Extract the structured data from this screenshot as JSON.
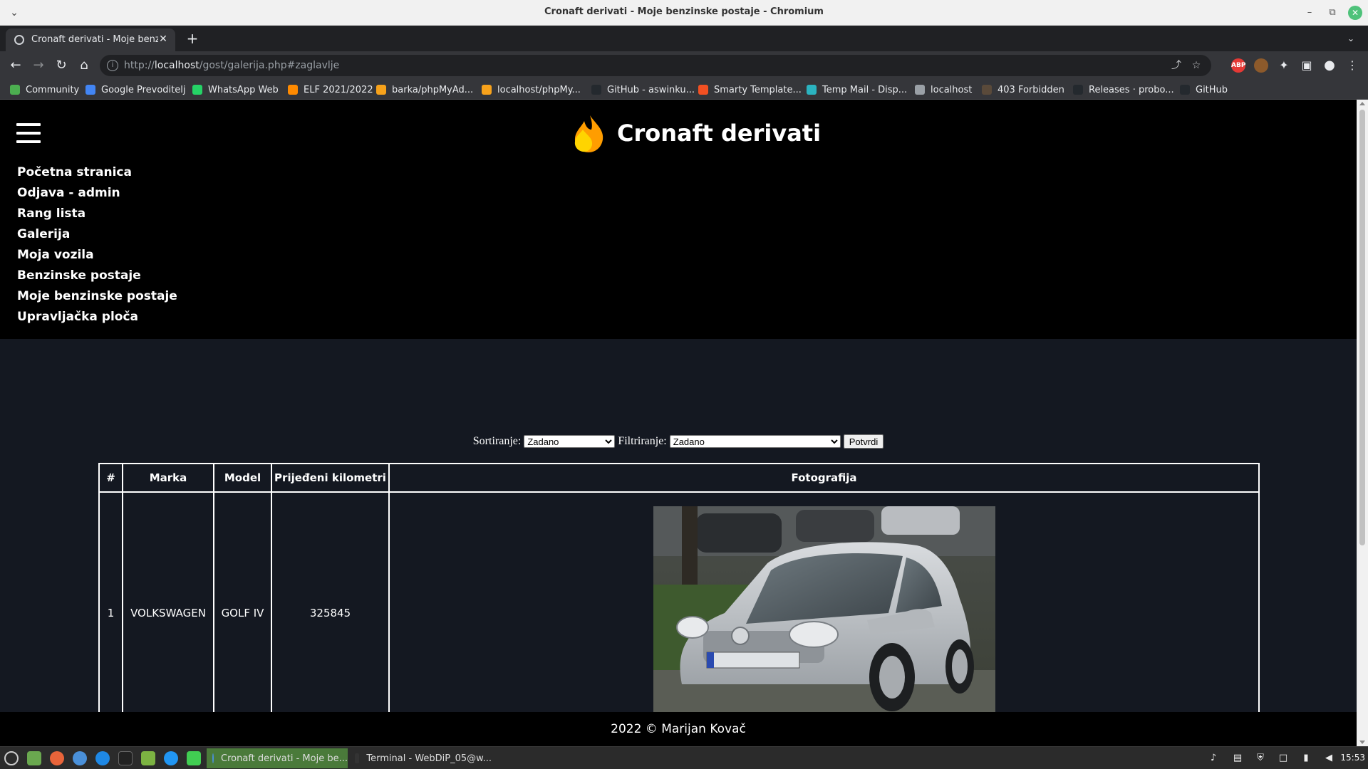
{
  "window": {
    "title": "Cronaft derivati - Moje benzinske postaje - Chromium"
  },
  "tab": {
    "title": "Cronaft derivati - Moje benzinske postaje"
  },
  "omnibox": {
    "url_prefix": "http://",
    "url_host": "localhost",
    "url_path": "/gost/galerija.php#zaglavlje"
  },
  "bookmarks": [
    {
      "label": "Community",
      "color": "#4caf50"
    },
    {
      "label": "Google Prevoditelj",
      "color": "#4285f4"
    },
    {
      "label": "WhatsApp Web",
      "color": "#25d366"
    },
    {
      "label": "ELF 2021/2022",
      "color": "#ff8a00"
    },
    {
      "label": "barka/phpMyAd...",
      "color": "#f7a21b"
    },
    {
      "label": "localhost/phpMy...",
      "color": "#f7a21b"
    },
    {
      "label": "GitHub - aswinku...",
      "color": "#24292e"
    },
    {
      "label": "Smarty Template...",
      "color": "#f25022"
    },
    {
      "label": "Temp Mail - Disp...",
      "color": "#2bb3c0"
    },
    {
      "label": "localhost",
      "color": "#9aa0a6"
    },
    {
      "label": "403 Forbidden",
      "color": "#5a4a3a"
    },
    {
      "label": "Releases · probo...",
      "color": "#24292e"
    },
    {
      "label": "GitHub",
      "color": "#24292e"
    }
  ],
  "site": {
    "title": "Cronaft derivati",
    "nav": [
      "Početna stranica",
      "Odjava - admin",
      "Rang lista",
      "Galerija",
      "Moja vozila",
      "Benzinske postaje",
      "Moje benzinske postaje",
      "Upravljačka ploča"
    ]
  },
  "filters": {
    "sort_label": "Sortiranje:",
    "sort_value": "Zadano",
    "filter_label": "Filtriranje:",
    "filter_value": "Zadano",
    "submit_label": "Potvrdi"
  },
  "table": {
    "headers": [
      "#",
      "Marka",
      "Model",
      "Prijeđeni kilometri",
      "Fotografija"
    ],
    "rows": [
      {
        "num": "1",
        "brand": "VOLKSWAGEN",
        "model": "GOLF IV",
        "km": "325845",
        "photo": "silver-volkswagen-golf-iv"
      }
    ]
  },
  "footer": {
    "text": "2022 © Marijan Kovač"
  },
  "taskbar": {
    "tasks": [
      "Cronaft derivati - Moje be...",
      "Terminal - WebDiP_05@w..."
    ],
    "clock": "15:53"
  },
  "colors": {
    "page_bg": "#141821",
    "header_bg": "#000000",
    "flame_orange": "#ff9d00",
    "flame_yellow": "#ffd400"
  }
}
